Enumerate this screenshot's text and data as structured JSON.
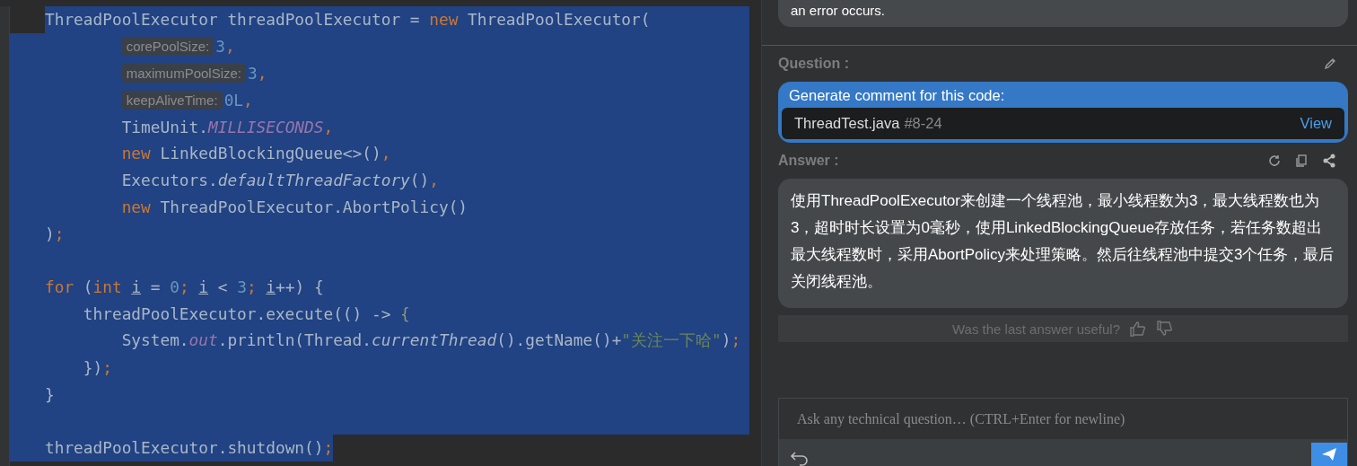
{
  "editor": {
    "lines": [
      {
        "selected": true,
        "tokens": [
          {
            "kind": "plain",
            "text": "ThreadPoolExecutor threadPoolExecutor = "
          },
          {
            "kind": "keyword",
            "text": "new"
          },
          {
            "kind": "plain",
            "text": " ThreadPoolExecutor("
          }
        ],
        "arguments": [
          {
            "selected": true,
            "tokens": [
              {
                "kind": "hint",
                "text": "corePoolSize:"
              },
              {
                "kind": "number",
                "text": "3"
              },
              {
                "kind": "keyword",
                "text": ","
              }
            ]
          },
          {
            "selected": true,
            "tokens": [
              {
                "kind": "hint",
                "text": "maximumPoolSize:"
              },
              {
                "kind": "number",
                "text": "3"
              },
              {
                "kind": "keyword",
                "text": ","
              }
            ]
          },
          {
            "selected": true,
            "tokens": [
              {
                "kind": "hint",
                "text": "keepAliveTime:"
              },
              {
                "kind": "number",
                "text": "0L"
              },
              {
                "kind": "keyword",
                "text": ","
              }
            ]
          },
          {
            "selected": true,
            "tokens": [
              {
                "kind": "plain",
                "text": "TimeUnit."
              },
              {
                "kind": "constant",
                "text": "MILLISECONDS"
              },
              {
                "kind": "keyword",
                "text": ","
              }
            ]
          },
          {
            "selected": true,
            "tokens": [
              {
                "kind": "keyword",
                "text": "new"
              },
              {
                "kind": "plain",
                "text": " LinkedBlockingQueue<>()"
              },
              {
                "kind": "keyword",
                "text": ","
              }
            ]
          },
          {
            "selected": true,
            "tokens": [
              {
                "kind": "plain",
                "text": "Executors."
              },
              {
                "kind": "italic",
                "text": "defaultThreadFactory"
              },
              {
                "kind": "plain",
                "text": "()"
              },
              {
                "kind": "keyword",
                "text": ","
              }
            ]
          },
          {
            "selected": true,
            "tokens": [
              {
                "kind": "keyword",
                "text": "new"
              },
              {
                "kind": "plain",
                "text": " ThreadPoolExecutor.AbortPolicy()"
              }
            ]
          }
        ]
      },
      {
        "selected": true,
        "tokens": [
          {
            "kind": "plain",
            "text": ")"
          },
          {
            "kind": "keyword",
            "text": ";"
          }
        ]
      },
      {
        "selected": true
      },
      {
        "selected": true,
        "tokens": [
          {
            "kind": "keyword",
            "text": "for"
          },
          {
            "kind": "plain",
            "text": " ("
          },
          {
            "kind": "keyword",
            "text": "int "
          },
          {
            "kind": "variable",
            "text": "i"
          },
          {
            "kind": "plain",
            "text": " = "
          },
          {
            "kind": "number",
            "text": "0"
          },
          {
            "kind": "keyword",
            "text": "; "
          },
          {
            "kind": "variable",
            "text": "i"
          },
          {
            "kind": "plain",
            "text": " < "
          },
          {
            "kind": "number",
            "text": "3"
          },
          {
            "kind": "keyword",
            "text": "; "
          },
          {
            "kind": "variable",
            "text": "i"
          },
          {
            "kind": "plain",
            "text": "++) {"
          }
        ],
        "children": [
          {
            "selected": true,
            "tokens": [
              {
                "kind": "plain",
                "text": "threadPoolExecutor.execute(() -> "
              },
              {
                "kind": "brace",
                "text": "{"
              }
            ],
            "children": [
              {
                "selected": true,
                "tokens": [
                  {
                    "kind": "plain",
                    "text": "System."
                  },
                  {
                    "kind": "constant",
                    "text": "out"
                  },
                  {
                    "kind": "plain",
                    "text": ".println(Thread."
                  },
                  {
                    "kind": "italic",
                    "text": "currentThread"
                  },
                  {
                    "kind": "plain",
                    "text": "().getName()+"
                  },
                  {
                    "kind": "string",
                    "text": "\"关注一下哈\""
                  },
                  {
                    "kind": "plain",
                    "text": ")"
                  },
                  {
                    "kind": "keyword",
                    "text": ";"
                  }
                ]
              }
            ]
          },
          {
            "selected": true,
            "tokens": [
              {
                "kind": "plain",
                "text": "})"
              },
              {
                "kind": "keyword",
                "text": ";"
              }
            ]
          }
        ]
      },
      {
        "selected": true,
        "tokens": [
          {
            "kind": "plain",
            "text": "}"
          }
        ]
      },
      {
        "selected": true
      },
      {
        "selected": true,
        "tokens": [
          {
            "kind": "plain",
            "text": "threadPoolExecutor.shutdown()"
          },
          {
            "kind": "keyword",
            "text": ";"
          }
        ]
      }
    ]
  },
  "chat": {
    "previous_answer_tail": "an error occurs.",
    "question": {
      "label": "Question :",
      "text": "Generate comment for this code:",
      "file": "ThreadTest.java",
      "range": "#8-24",
      "link": "View"
    },
    "answer": {
      "label": "Answer :",
      "text": "使用ThreadPoolExecutor来创建一个线程池，最小线程数为3，最大线程数也为3，超时时长设置为0毫秒，使用LinkedBlockingQueue存放任务，若任务数超出最大线程数时，采用AbortPolicy来处理策略。然后往线程池中提交3个任务，最后关闭线程池。"
    },
    "feedback": "Was the last answer useful?",
    "input": {
      "placeholder": "Ask any technical question… (CTRL+Enter for newline)"
    }
  }
}
